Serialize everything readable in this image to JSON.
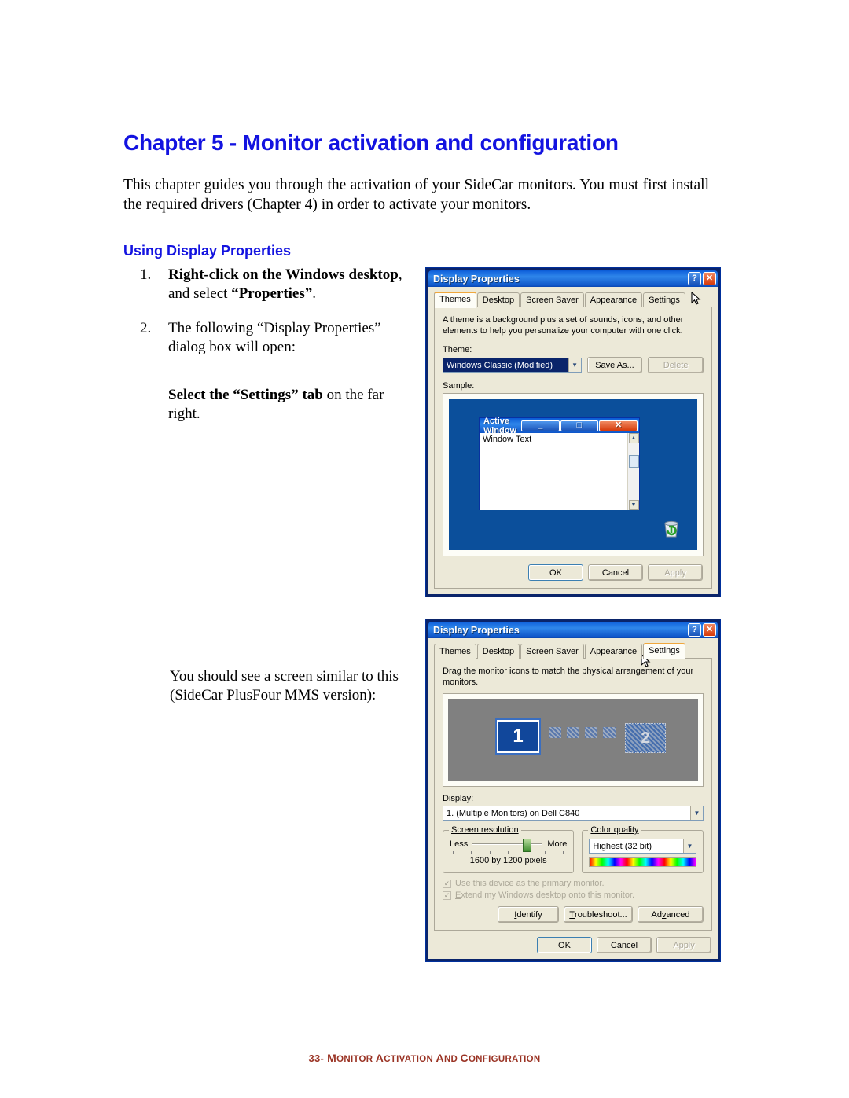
{
  "document": {
    "chapter_title": "Chapter 5 - Monitor activation and configuration",
    "intro_paragraph": "This chapter guides you through the activation of your SideCar monitors. You must first install the required drivers (Chapter 4) in order to activate your monitors.",
    "section_heading": "Using Display Properties",
    "steps": [
      {
        "number": "1.",
        "bold_lead": "Right-click on the Windows desktop",
        "rest": ", and select ",
        "bold_tail": "“Properties”",
        "end": "."
      },
      {
        "number": "2.",
        "text": "The following “Display Properties” dialog box will open:"
      }
    ],
    "sub_note_bold": "Select the “Settings” tab",
    "sub_note_rest": " on the far right.",
    "paragraph_two": "You should see a screen similar to this (SideCar PlusFour MMS version):",
    "footer_page": "33-",
    "footer_text": "Monitor activation and configuration",
    "colors": {
      "heading_blue": "#1313e0",
      "footer_brown": "#9a3324",
      "xp_title_blue": "#0a5ad4",
      "xp_face": "#ece9d8"
    }
  },
  "dialog_themes": {
    "title": "Display Properties",
    "help_button": "?",
    "close_button": "✕",
    "tabs": [
      {
        "label": "Themes",
        "active": true
      },
      {
        "label": "Desktop",
        "active": false
      },
      {
        "label": "Screen Saver",
        "active": false
      },
      {
        "label": "Appearance",
        "active": false
      },
      {
        "label": "Settings",
        "active": false
      }
    ],
    "description": "A theme is a background plus a set of sounds, icons, and other elements to help you personalize your computer with one click.",
    "theme_label": "Theme:",
    "theme_value": "Windows Classic (Modified)",
    "save_as_button": "Save As...",
    "delete_button": "Delete",
    "sample_label": "Sample:",
    "sample": {
      "window_title": "Active Window",
      "window_text": "Window Text",
      "minimize": "_",
      "maximize": "□",
      "close": "✕",
      "scroll_up": "▲",
      "scroll_down": "▼",
      "recycle_bin_icon": "recycle-bin-icon"
    },
    "ok_button": "OK",
    "cancel_button": "Cancel",
    "apply_button": "Apply"
  },
  "dialog_settings": {
    "title": "Display Properties",
    "help_button": "?",
    "close_button": "✕",
    "tabs": [
      {
        "label": "Themes",
        "active": false
      },
      {
        "label": "Desktop",
        "active": false
      },
      {
        "label": "Screen Saver",
        "active": false
      },
      {
        "label": "Appearance",
        "active": false
      },
      {
        "label": "Settings",
        "active": true
      }
    ],
    "instruction": "Drag the monitor icons to match the physical arrangement of your monitors.",
    "monitors": {
      "primary_label": "1",
      "secondary_label": "2",
      "extra_count": 4
    },
    "display_label": "Display:",
    "display_value": "1. (Multiple Monitors) on Dell C840",
    "screen_resolution": {
      "caption": "Screen resolution",
      "less_label": "Less",
      "more_label": "More",
      "value": "1600 by 1200 pixels"
    },
    "color_quality": {
      "caption": "Color quality",
      "value": "Highest (32 bit)"
    },
    "checkbox_primary": "Use this device as the primary monitor.",
    "checkbox_extend": "Extend my Windows desktop onto this monitor.",
    "identify_button": "Identify",
    "troubleshoot_button": "Troubleshoot...",
    "advanced_button": "Advanced",
    "ok_button": "OK",
    "cancel_button": "Cancel",
    "apply_button": "Apply"
  }
}
